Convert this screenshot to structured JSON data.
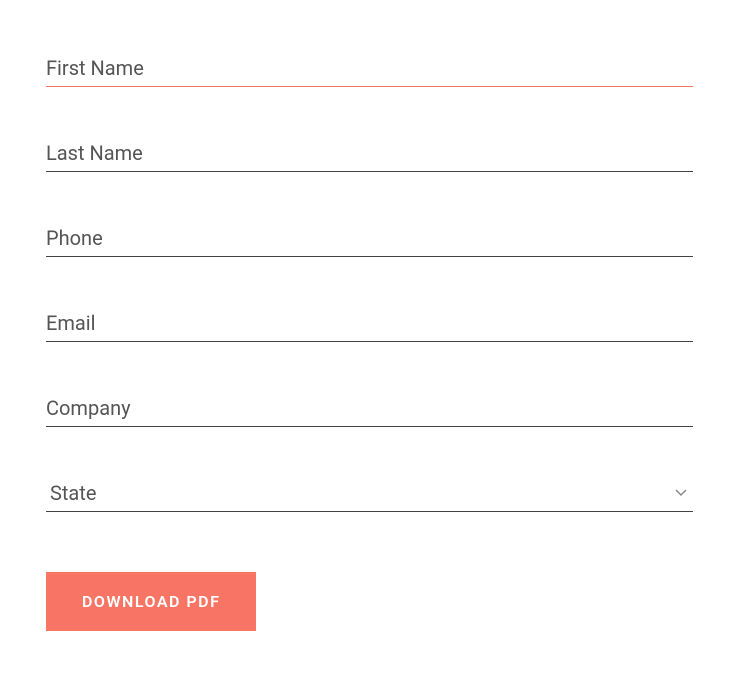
{
  "form": {
    "fields": {
      "first_name": {
        "placeholder": "First Name",
        "value": ""
      },
      "last_name": {
        "placeholder": "Last Name",
        "value": ""
      },
      "phone": {
        "placeholder": "Phone",
        "value": ""
      },
      "email": {
        "placeholder": "Email",
        "value": ""
      },
      "company": {
        "placeholder": "Company",
        "value": ""
      },
      "state": {
        "selected": "State"
      }
    },
    "submit_label": "DOWNLOAD PDF"
  },
  "colors": {
    "accent": "#f87565",
    "text": "#555555",
    "border": "#444444"
  }
}
